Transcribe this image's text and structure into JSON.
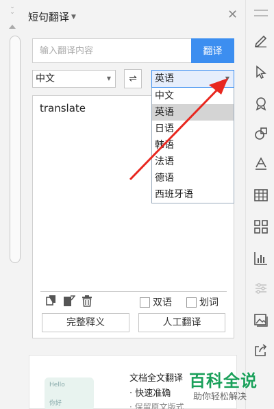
{
  "panel": {
    "title": "短句翻译",
    "close_glyph": "✕"
  },
  "input": {
    "placeholder": "输入翻译内容",
    "translate_button": "翻译"
  },
  "languages": {
    "source": "中文",
    "target": "英语",
    "swap_glyph": "⇌"
  },
  "result": {
    "text": "translate",
    "checkbox_bilingual": "双语",
    "checkbox_word_select": "划词",
    "full_definition_button": "完整释义",
    "human_translation_button": "人工翻译"
  },
  "dropdown": {
    "options": [
      "中文",
      "英语",
      "日语",
      "韩语",
      "法语",
      "德语",
      "西班牙语"
    ],
    "highlighted_index": 1
  },
  "promo": {
    "title": "文档全文翻译",
    "bullet1": "· 快速准确",
    "bullet2": "· 保留原文版式",
    "image_text1": "Hello",
    "image_text2": "你好"
  },
  "watermark": {
    "brand": "百科全说",
    "slogan": "助你轻松解决"
  },
  "colors": {
    "accent": "#3c8ef0",
    "arrow": "#e8271f",
    "watermark_green": "#1aa05a"
  },
  "icons": {
    "toolbar": [
      "pen-icon",
      "cursor-icon",
      "badge-icon",
      "shapes-icon",
      "text-style-icon",
      "table-icon",
      "grid-icon",
      "bar-chart-icon",
      "sliders-icon",
      "image-gallery-icon",
      "share-icon"
    ],
    "result_tools": [
      "copy-icon",
      "edit-doc-icon",
      "trash-icon"
    ]
  }
}
